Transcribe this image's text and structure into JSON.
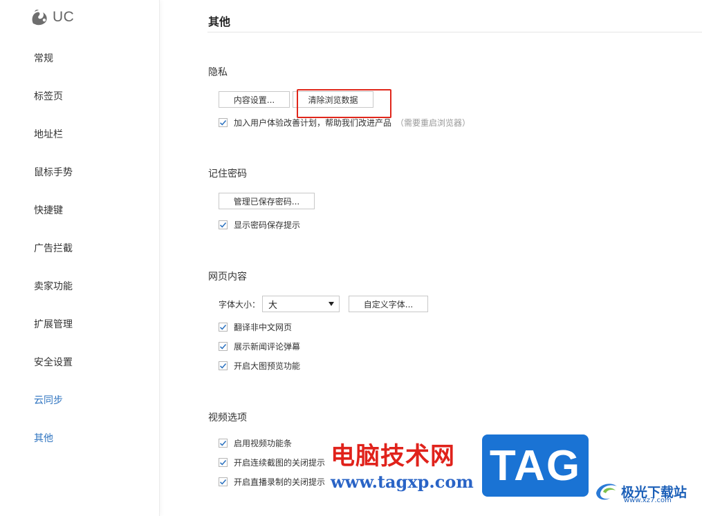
{
  "logo": {
    "text": "UC"
  },
  "sidebar": {
    "items": [
      {
        "label": "常规"
      },
      {
        "label": "标签页"
      },
      {
        "label": "地址栏"
      },
      {
        "label": "鼠标手势"
      },
      {
        "label": "快捷键"
      },
      {
        "label": "广告拦截"
      },
      {
        "label": "卖家功能"
      },
      {
        "label": "扩展管理"
      },
      {
        "label": "安全设置"
      },
      {
        "label": "云同步"
      },
      {
        "label": "其他"
      }
    ]
  },
  "page": {
    "title": "其他"
  },
  "privacy": {
    "title": "隐私",
    "content_settings_btn": "内容设置...",
    "clear_data_btn": "清除浏览数据",
    "ux_plan": {
      "label": "加入用户体验改善计划，帮助我们改进产品",
      "hint": "（需要重启浏览器）",
      "checked": true
    }
  },
  "passwords": {
    "title": "记住密码",
    "manage_btn": "管理已保存密码...",
    "show_prompt": {
      "label": "显示密码保存提示",
      "checked": true
    }
  },
  "webcontent": {
    "title": "网页内容",
    "font_size_label": "字体大小：",
    "font_size_value": "大",
    "custom_font_btn": "自定义字体...",
    "options": [
      {
        "label": "翻译非中文网页",
        "checked": true
      },
      {
        "label": "展示新闻评论弹幕",
        "checked": true
      },
      {
        "label": "开启大图预览功能",
        "checked": true
      }
    ]
  },
  "video": {
    "title": "视频选项",
    "options": [
      {
        "label": "启用视频功能条",
        "checked": true
      },
      {
        "label": "开启连续截图的关闭提示",
        "checked": true
      },
      {
        "label": "开启直播录制的关闭提示",
        "checked": true
      }
    ]
  },
  "watermark": {
    "cn_text": "电脑技术网",
    "url": "www.tagxp.com",
    "tag": "TAG",
    "site": "极光下载站",
    "site_url": "www.xz7.com"
  },
  "colors": {
    "accent": "#2f74c0",
    "highlight_box": "#e0261a"
  }
}
